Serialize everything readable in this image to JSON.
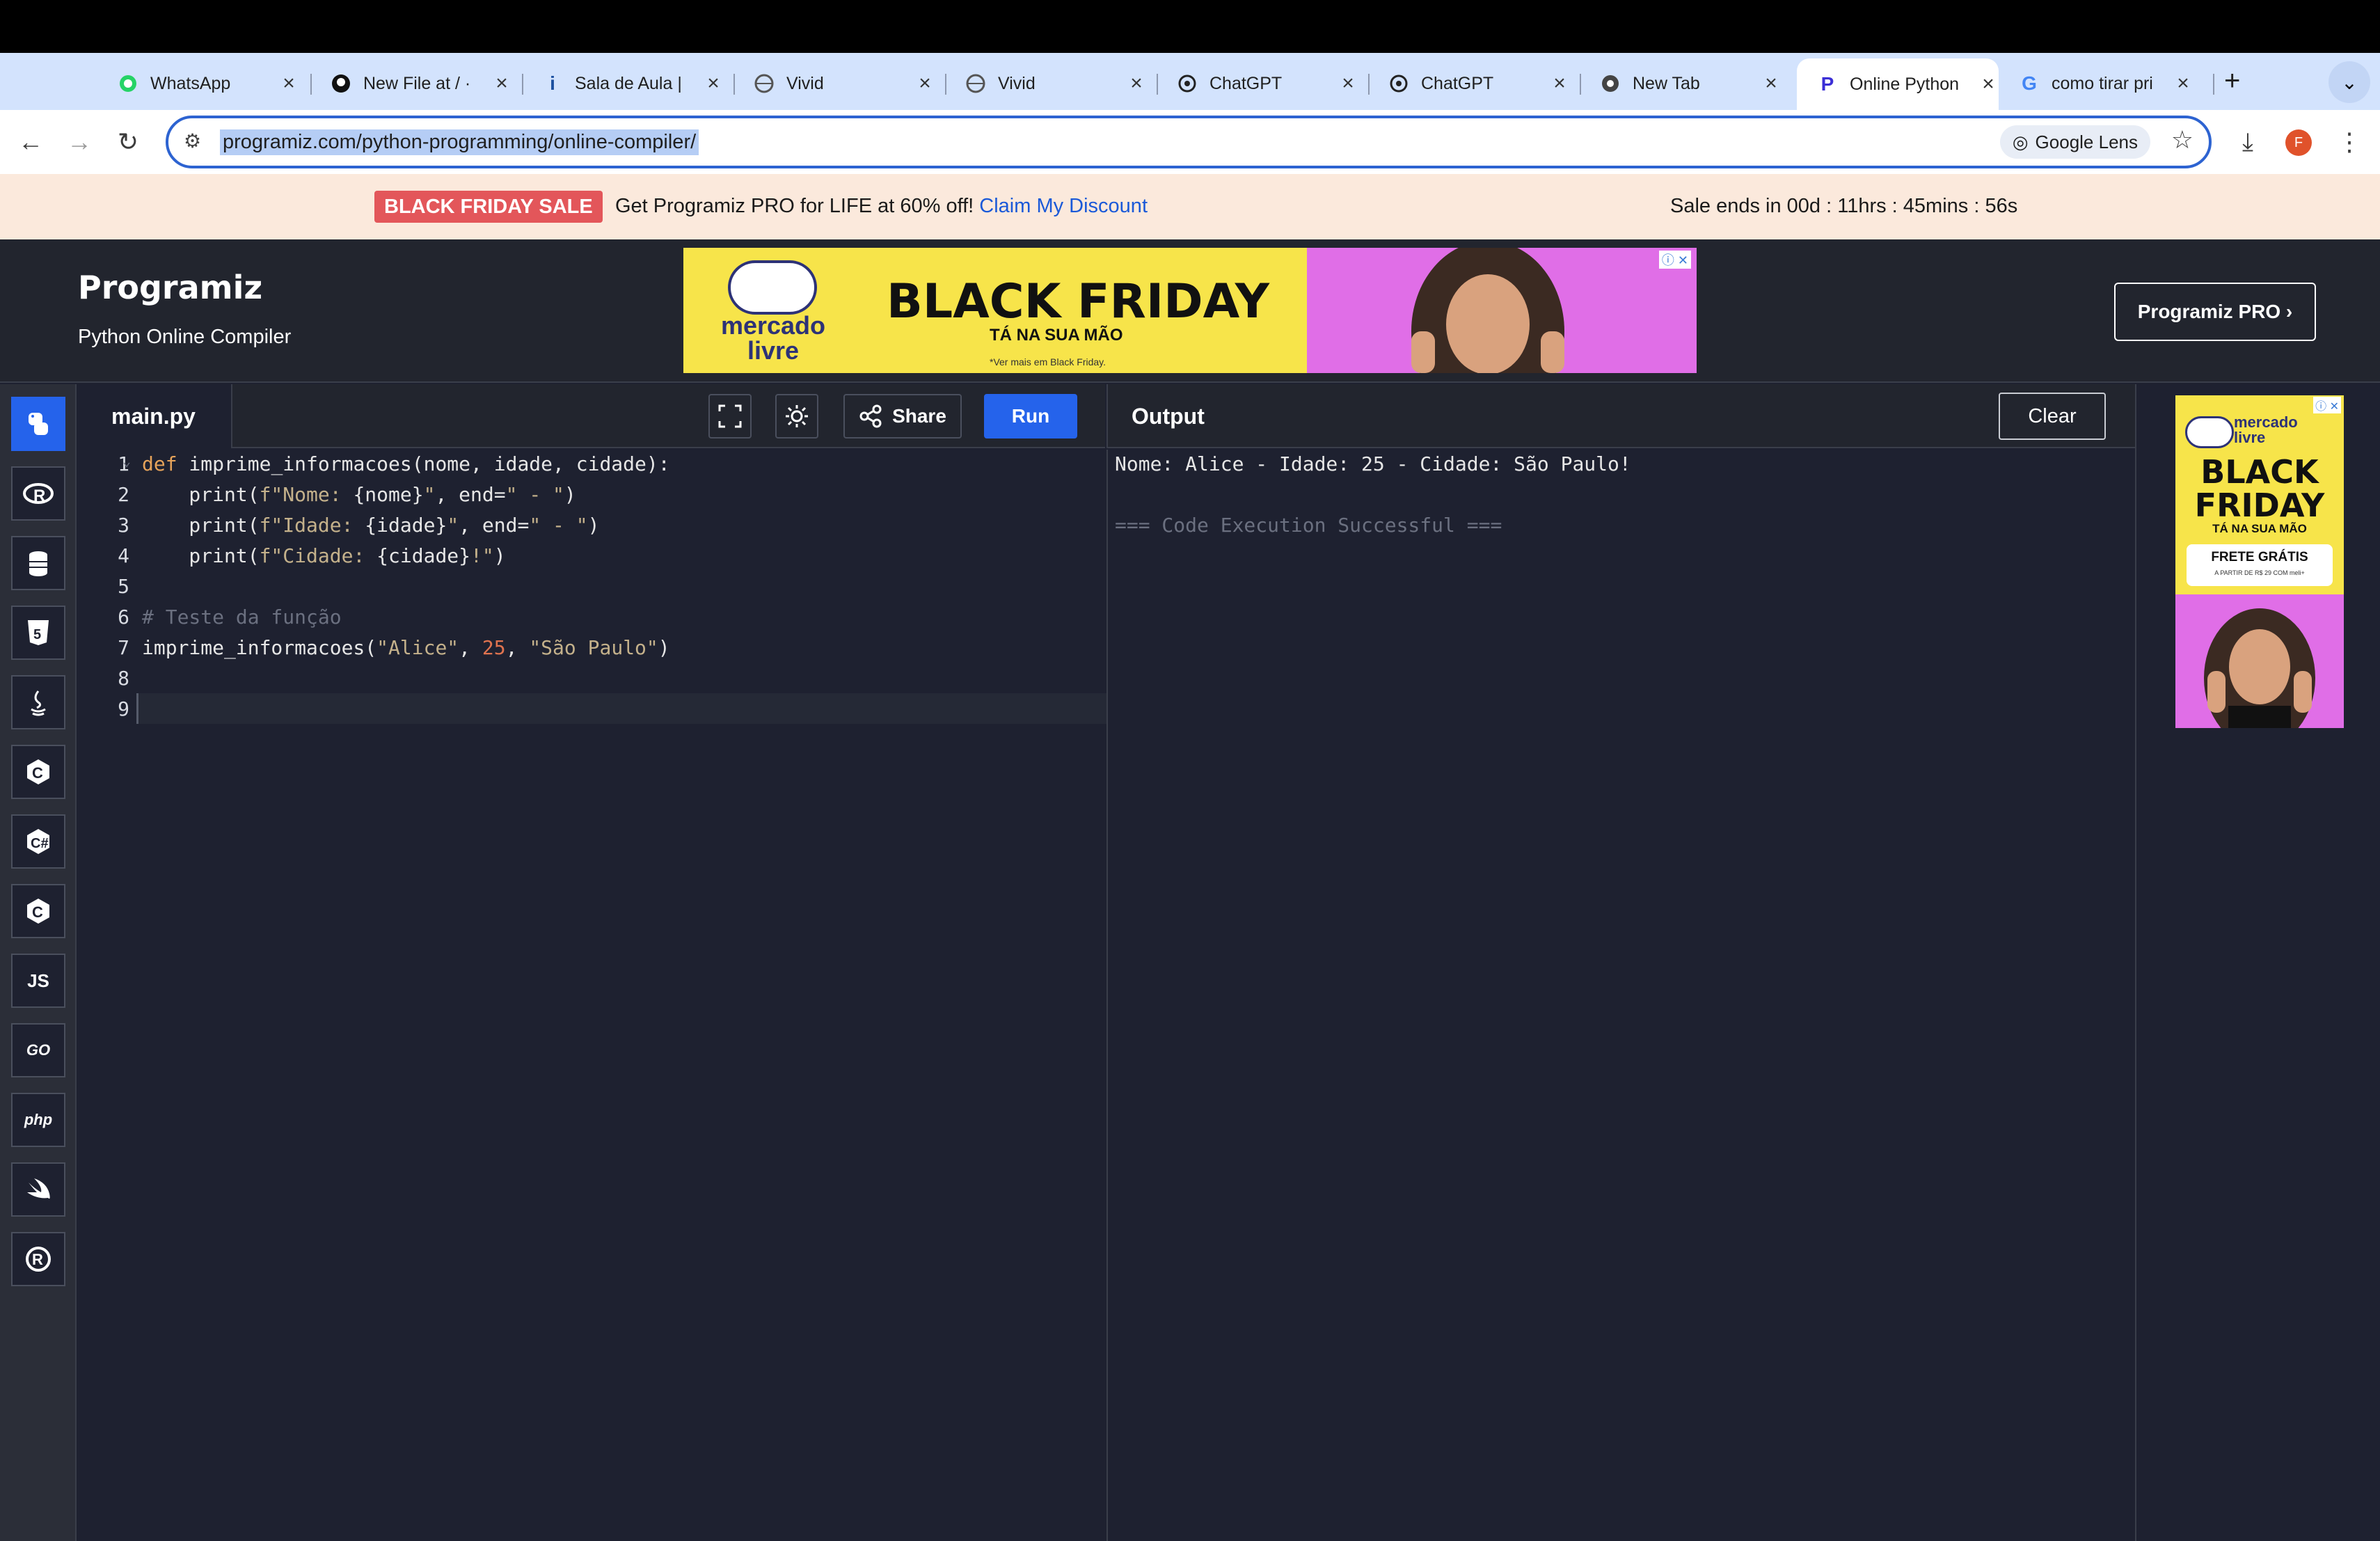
{
  "browser": {
    "tabs": [
      {
        "title": "WhatsApp",
        "icon": "whatsapp-icon",
        "active": false
      },
      {
        "title": "New File at / ·",
        "icon": "github-icon",
        "active": false
      },
      {
        "title": "Sala de Aula |",
        "icon": "info-icon",
        "active": false
      },
      {
        "title": "Vivid",
        "icon": "globe-icon",
        "active": false
      },
      {
        "title": "Vivid",
        "icon": "globe-icon",
        "active": false
      },
      {
        "title": "ChatGPT",
        "icon": "chatgpt-icon",
        "active": false
      },
      {
        "title": "ChatGPT",
        "icon": "chatgpt-icon",
        "active": false
      },
      {
        "title": "New Tab",
        "icon": "chrome-icon",
        "active": false
      },
      {
        "title": "Online Python",
        "icon": "programiz-icon",
        "active": true
      },
      {
        "title": "como tirar pri",
        "icon": "google-icon",
        "active": false
      }
    ],
    "new_tab": "+",
    "url": "programiz.com/python-programming/online-compiler/",
    "lens_label": "Google Lens",
    "profile_initial": "F"
  },
  "sale_banner": {
    "tag": "BLACK FRIDAY SALE",
    "text": "Get Programiz PRO for LIFE at 60% off!",
    "link": "Claim My Discount",
    "timer": "Sale ends in 00d : 11hrs : 45mins : 56s"
  },
  "header": {
    "logo": "Programiz",
    "subtitle": "Python Online Compiler",
    "pro_button": "Programiz PRO ›",
    "ad": {
      "brand": "mercado livre",
      "headline": "BLACK FRIDAY",
      "tagline": "TÁ NA SUA MÃO",
      "fine_print": "*Ver mais em Black Friday."
    }
  },
  "sidebar": {
    "languages": [
      "python-icon",
      "r-icon",
      "sql-icon",
      "html-icon",
      "java-icon",
      "c-icon",
      "csharp-icon",
      "cpp-icon",
      "js-icon",
      "go-icon",
      "php-icon",
      "swift-icon",
      "rust-icon"
    ],
    "labels": {
      "js": "JS",
      "go": "GO",
      "php": "php"
    }
  },
  "editor": {
    "filename": "main.py",
    "share_label": "Share",
    "run_label": "Run",
    "line_numbers": [
      "1",
      "2",
      "3",
      "4",
      "5",
      "6",
      "7",
      "8",
      "9"
    ]
  },
  "output": {
    "title": "Output",
    "clear_label": "Clear",
    "line1": "Nome: Alice - Idade: 25 - Cidade: São Paulo!",
    "line2": "=== Code Execution Successful ==="
  },
  "side_ad": {
    "brand": "mercado livre",
    "headline": "BLACK FRIDAY",
    "tagline": "TÁ NA SUA MÃO",
    "offer": "FRETE GRÁTIS",
    "offer_note": "A PARTIR DE R$ 29 COM meli+"
  },
  "colors": {
    "accent": "#2563eb",
    "editor_bg": "#1e2130",
    "sale_tag": "#e3565a",
    "ad_yellow": "#f7e44a",
    "ad_pink": "#e06ee7"
  }
}
